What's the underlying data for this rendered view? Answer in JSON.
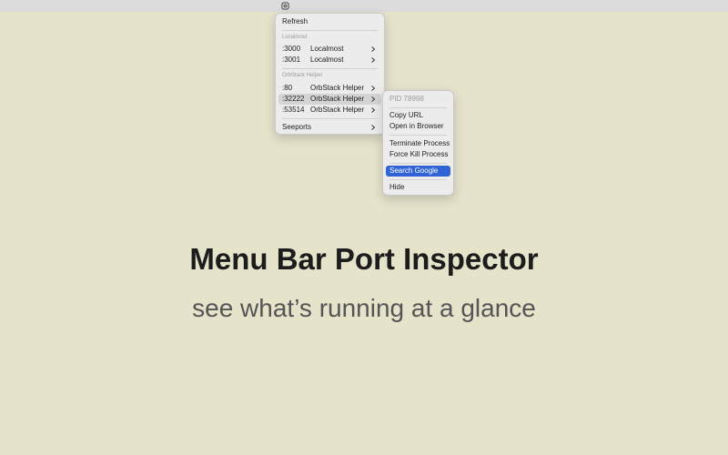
{
  "menubar": {
    "icon": "hexagon-port-icon"
  },
  "main_menu": {
    "refresh_label": "Refresh",
    "sections": [
      {
        "label": "Localmost",
        "items": [
          {
            "port": ":3000",
            "name": "Localmost"
          },
          {
            "port": ":3001",
            "name": "Localmost"
          }
        ]
      },
      {
        "label": "OrbStack Helper",
        "items": [
          {
            "port": ":80",
            "name": "OrbStack Helper"
          },
          {
            "port": ":32222",
            "name": "OrbStack Helper"
          },
          {
            "port": ":53514",
            "name": "OrbStack Helper"
          }
        ]
      }
    ],
    "seeports_label": "Seeports"
  },
  "sub_menu": {
    "pid_label": "PID 78998",
    "copy_url": "Copy URL",
    "open_browser": "Open in Browser",
    "terminate": "Terminate Process",
    "force_kill": "Force Kill Process",
    "search_google": "Search Google",
    "hide": "Hide"
  },
  "hero": {
    "title": "Menu Bar Port Inspector",
    "subtitle": "see what’s running at a glance"
  },
  "colors": {
    "background": "#e6e3cb",
    "selection": "#3063d6"
  }
}
